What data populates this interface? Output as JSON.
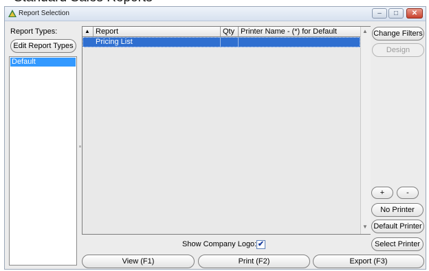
{
  "background": {
    "cut_text": "Standard Sales Reports"
  },
  "window": {
    "title": "Report Selection",
    "controls": {
      "minimize": "–",
      "maximize": "□",
      "close": "✕"
    }
  },
  "left_panel": {
    "report_types_label": "Report Types:",
    "edit_button": "Edit Report Types",
    "types": [
      "Default"
    ],
    "selected_index": 0
  },
  "grid": {
    "columns": [
      "Report",
      "Qty",
      "Printer Name - (*) for Default"
    ],
    "sort_indicator": "▲",
    "rows": [
      {
        "report": "Pricing List",
        "qty": "",
        "printer": ""
      }
    ],
    "selected_row": 0
  },
  "right_panel": {
    "change_filters": "Change Filters",
    "design": "Design",
    "plus": "+",
    "minus": "-",
    "no_printer": "No Printer",
    "default_printer": "Default Printer",
    "select_printer": "Select Printer"
  },
  "options": {
    "show_logo_label": "Show Company Logo:",
    "show_logo_checked": true,
    "check_glyph": "✔"
  },
  "bottom": {
    "view": "View (F1)",
    "print": "Print (F2)",
    "export": "Export (F3)"
  },
  "colors": {
    "selection": "#3399ff",
    "grid_selection": "#2f6fd0",
    "window_bg": "#ececec"
  },
  "icons": {
    "app": "report-tree-icon",
    "scroll_up": "scroll-up-icon",
    "scroll_down": "scroll-down-icon"
  }
}
